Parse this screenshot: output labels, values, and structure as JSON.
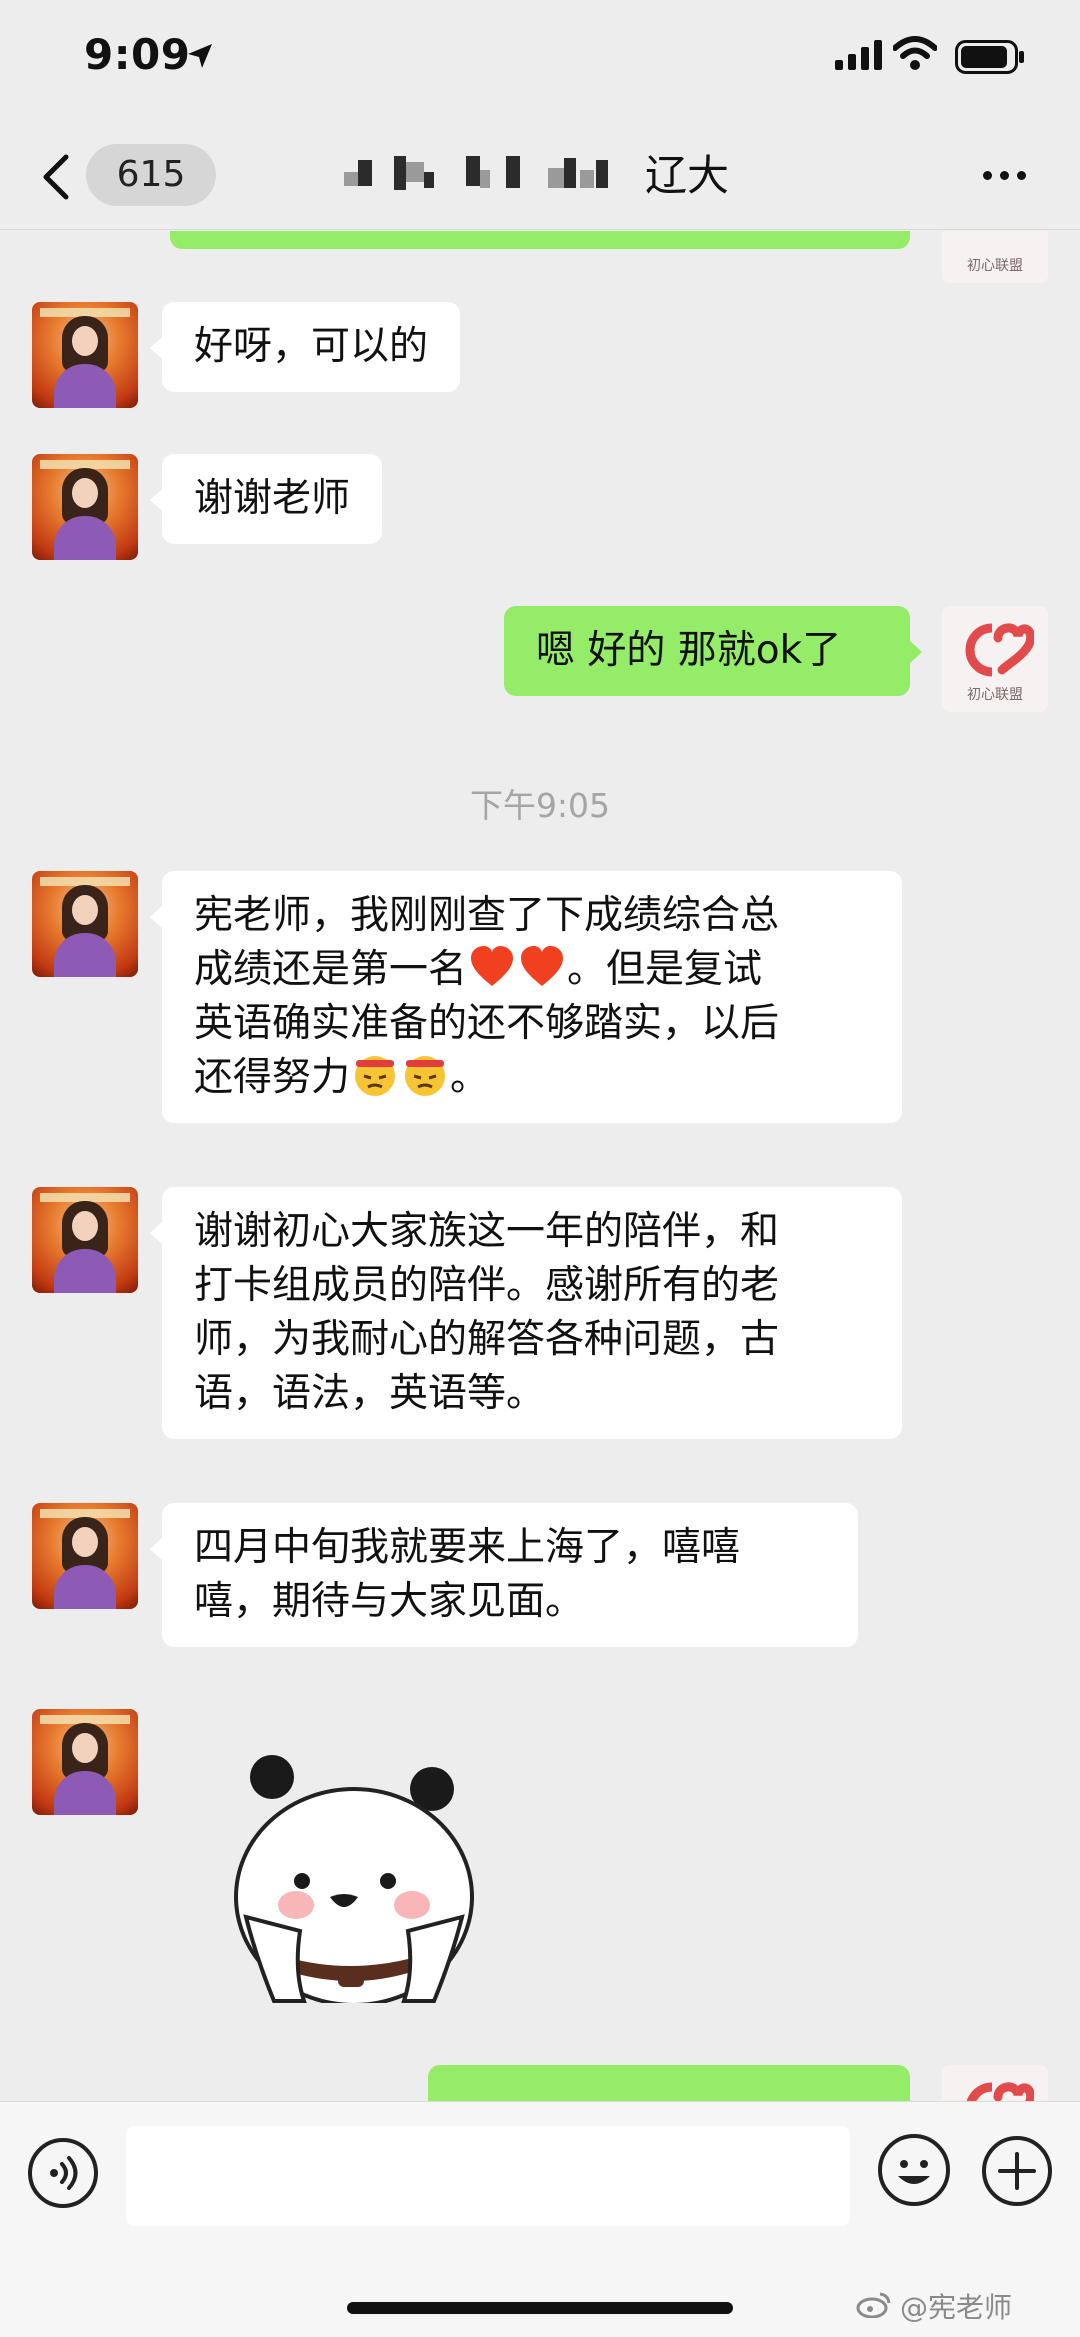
{
  "status_bar": {
    "time": "9:09"
  },
  "nav": {
    "unread_count": "615",
    "title_suffix": "辽大"
  },
  "messages": [
    {
      "side": "left",
      "text": "好呀，可以的"
    },
    {
      "side": "left",
      "text": "谢谢老师"
    },
    {
      "side": "right",
      "text": "嗯 好的 那就ok了"
    },
    {
      "side": "left",
      "lines": [
        "宪老师，我刚刚查了下成绩综合总",
        "成绩还是第一名",
        "。但是复试",
        "英语确实准备的还不够踏实，以后",
        "还得努力",
        "。"
      ]
    },
    {
      "side": "left",
      "lines": [
        "谢谢初心大家族这一年的陪伴，和",
        "打卡组成员的陪伴。感谢所有的老",
        "师，为我耐心的解答各种问题，古",
        "语，语法，英语等。"
      ]
    },
    {
      "side": "left",
      "lines": [
        "四月中旬我就要来上海了，嘻嘻",
        "嘻，期待与大家见面。"
      ]
    }
  ],
  "timestamp": "下午9:05",
  "avatar_brand": "初心联盟",
  "watermark": "@宪老师",
  "icons": {
    "back": "chevron-left-icon",
    "more": "more-dots-icon",
    "voice": "voice-icon",
    "emoji": "emoji-icon",
    "plus": "plus-icon",
    "heart": "red-heart-emoji",
    "determined": "headband-face-emoji"
  },
  "colors": {
    "sent_bubble": "#95ec69",
    "received_bubble": "#ffffff",
    "background": "#ededed"
  }
}
